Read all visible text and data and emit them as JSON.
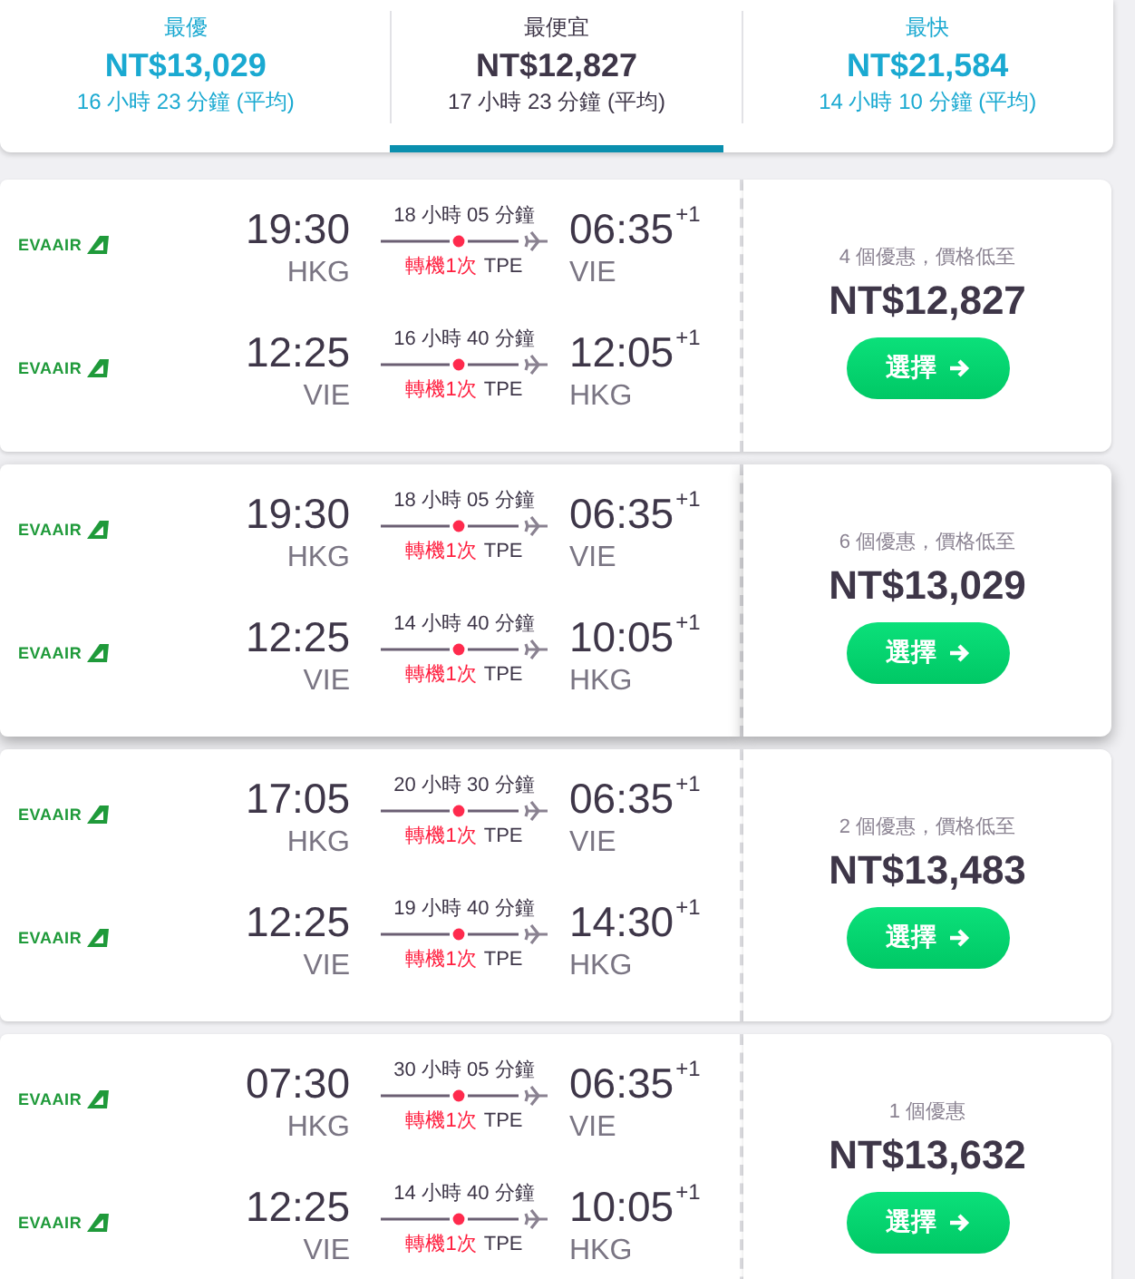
{
  "sort_tabs": [
    {
      "label": "最優",
      "price": "NT$13,029",
      "duration": "16 小時 23 分鐘 (平均)",
      "selected": false
    },
    {
      "label": "最便宜",
      "price": "NT$12,827",
      "duration": "17 小時 23 分鐘 (平均)",
      "selected": true
    },
    {
      "label": "最快",
      "price": "NT$21,584",
      "duration": "14 小時 10 分鐘 (平均)",
      "selected": false
    }
  ],
  "results": [
    {
      "hovered": false,
      "deals": "4 個優惠，價格低至",
      "price": "NT$12,827",
      "button": "選擇",
      "legs": [
        {
          "airline": "EVAAIR",
          "depart_time": "19:30",
          "depart_airport": "HKG",
          "duration": "18 小時 05 分鐘",
          "stops": "轉機1次",
          "via": "TPE",
          "arrive_time": "06:35",
          "day_offset": "+1",
          "arrive_airport": "VIE"
        },
        {
          "airline": "EVAAIR",
          "depart_time": "12:25",
          "depart_airport": "VIE",
          "duration": "16 小時 40 分鐘",
          "stops": "轉機1次",
          "via": "TPE",
          "arrive_time": "12:05",
          "day_offset": "+1",
          "arrive_airport": "HKG"
        }
      ]
    },
    {
      "hovered": true,
      "deals": "6 個優惠，價格低至",
      "price": "NT$13,029",
      "button": "選擇",
      "legs": [
        {
          "airline": "EVAAIR",
          "depart_time": "19:30",
          "depart_airport": "HKG",
          "duration": "18 小時 05 分鐘",
          "stops": "轉機1次",
          "via": "TPE",
          "arrive_time": "06:35",
          "day_offset": "+1",
          "arrive_airport": "VIE"
        },
        {
          "airline": "EVAAIR",
          "depart_time": "12:25",
          "depart_airport": "VIE",
          "duration": "14 小時 40 分鐘",
          "stops": "轉機1次",
          "via": "TPE",
          "arrive_time": "10:05",
          "day_offset": "+1",
          "arrive_airport": "HKG"
        }
      ]
    },
    {
      "hovered": false,
      "deals": "2 個優惠，價格低至",
      "price": "NT$13,483",
      "button": "選擇",
      "legs": [
        {
          "airline": "EVAAIR",
          "depart_time": "17:05",
          "depart_airport": "HKG",
          "duration": "20 小時 30 分鐘",
          "stops": "轉機1次",
          "via": "TPE",
          "arrive_time": "06:35",
          "day_offset": "+1",
          "arrive_airport": "VIE"
        },
        {
          "airline": "EVAAIR",
          "depart_time": "12:25",
          "depart_airport": "VIE",
          "duration": "19 小時 40 分鐘",
          "stops": "轉機1次",
          "via": "TPE",
          "arrive_time": "14:30",
          "day_offset": "+1",
          "arrive_airport": "HKG"
        }
      ]
    },
    {
      "hovered": false,
      "deals": "1 個優惠",
      "price": "NT$13,632",
      "button": "選擇",
      "legs": [
        {
          "airline": "EVAAIR",
          "depart_time": "07:30",
          "depart_airport": "HKG",
          "duration": "30 小時 05 分鐘",
          "stops": "轉機1次",
          "via": "TPE",
          "arrive_time": "06:35",
          "day_offset": "+1",
          "arrive_airport": "VIE"
        },
        {
          "airline": "EVAAIR",
          "depart_time": "12:25",
          "depart_airport": "VIE",
          "duration": "14 小時 40 分鐘",
          "stops": "轉機1次",
          "via": "TPE",
          "arrive_time": "10:05",
          "day_offset": "+1",
          "arrive_airport": "HKG"
        }
      ]
    }
  ]
}
